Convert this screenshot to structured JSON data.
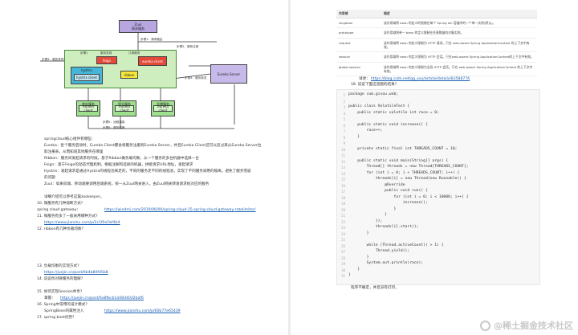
{
  "left_page": {
    "diagram": {
      "zuul": "Zuul\n网关服务",
      "step1": "步骤1：请求路由",
      "step2": "步骤2：服务注册",
      "step3": "步骤3：服务发现",
      "step4": "步骤4：服务转发",
      "step5": "步骤5：服务熔断",
      "config_labels": [
        "配置",
        "服务中心"
      ],
      "inner_labels": [
        "步骤1",
        "服务发现",
        "订单服务"
      ],
      "feign": "feign",
      "eureka_client": "eureka client",
      "hystrix": "hystrix",
      "hystrix_client": "hystrix client",
      "ribbon": "ribbon",
      "eureka_server": "Eureka Server",
      "services": [
        "库存服务",
        "积分服务",
        "仓储服务"
      ],
      "bottom_label1": "步骤5：远程调用",
      "bottom_label2": "步骤6：服务熔断"
    },
    "text_lines": [
      "springcloud核心组件有哪些：",
      "Eureka：各个服务启动时，Eureka Client都会将服务注册到Eureka Server，并且Eureka Client还可以反过来从Eureka Server拉",
      "取注册表，从而知道其他服务在哪里",
      "Ribbon：服务间发起请求的时候，基于Ribbon做负载均衡，从一个服务的多台机器中选择一台",
      "Feign：基于Feign的动态代理机制，根据注解和选择的机器，拼接请求URL地址，发起请求",
      "Hystrix：发起请求是通过Hystrix的线程池来走的，不同的服务走不同的线程池，实现了不同服务调用的隔离，避免了服务雪崩",
      "的问题",
      "Zuul：如果前端、移动端要调用后端系统，统一从Zuul网关进入，由Zuul网关转发请求给对应的服务"
    ],
    "list_lines": [
      "    详细介绍可以参考这篇zookeeper。",
      "10. 微服务有几种熔断方式?",
      "    spring cloud gateway：",
      "11. 微服务有多了一般采用哪种方式?",
      "12. ribbon有几种负载均衡?",
      "13. 负载均衡的实现方式?",
      "14. 说说你对微服务的理解?",
      "15. 如何实现Session共享?",
      "    掌握：",
      "16. Spring中常用的设计模式?",
      "    SpringBean的属性注入",
      "17. spring boot优势?"
    ],
    "links": [
      "https://windmi.com/2019/06/06/spring-cloud-15-spring-cloud-gateway-ratelimiter/",
      "https://www.jianshu.com/p/2c1f0e1bf4b4",
      "https://juejin.cn/post/6b4b80fd5b8",
      "https://juejin.cn/post/6a8fbcb1a08d40d2baf6",
      "https://www.jianshu.com/p/60b77e65439"
    ]
  },
  "right_page": {
    "table": {
      "headers": [
        "作用域",
        "描述"
      ],
      "rows": [
        {
          "name": "singleton",
          "desc": "该作用域将 bean 的定义的限制在每个 Spring IoC 容器中的一个单一实例(默认)。"
        },
        {
          "name": "prototype",
          "desc": "该作用域将单一 bean 的定义限制在任意数量的对象实例。"
        },
        {
          "name": "request",
          "desc": "该作用域将 bean 的定义限制为 HTTP 请求。只在 web-aware Spring ApplicationContext 的上下文中有效。"
        },
        {
          "name": "session",
          "desc": "该作用域将 bean 的定义限制为 HTTP 会话。只在web-aware Spring ApplicationContext的上下文中有效。"
        },
        {
          "name": "global-session",
          "desc": "该作用域将 bean 的定义限制为全局 HTTP 会话。只在 web-aware Spring ApplicationContext 的上下文中有效。"
        }
      ]
    },
    "details_label": "详述：",
    "details_link": "https://blog.csdn.net/qq_xxx/article/details/83588776",
    "q18": "18. 说说下面这道题的结果?",
    "code": [
      "package com.givou.web;",
      "",
      "public class VolatileTest {",
      "    public static volatile int race = 0;",
      "",
      "    public static void increase() {",
      "        race++;",
      "    }",
      "",
      "    private static final int THREADS_COUNT = 10;",
      "",
      "    public static void main(String[] args) {",
      "        Thread[] threads = new Thread[THREADS_COUNT];",
      "        for (int i = 0; i < THREADS_COUNT; i++) {",
      "            threads[i] = new Thread(new Runnable() {",
      "                @Override",
      "                public void run() {",
      "                    for (int i = 0; i < 10000; i++) {",
      "                        increase();",
      "                    }",
      "                }",
      "            });",
      "            threads[i].start();",
      "        }",
      "",
      "        while (Thread.activeCount() > 1) {",
      "            Thread.yield();",
      "        }",
      "        System.out.println(race);",
      "    }",
      "}"
    ],
    "answer": "程序不确定，并且没有打印。"
  },
  "watermark": "@稀土掘金技术社区"
}
